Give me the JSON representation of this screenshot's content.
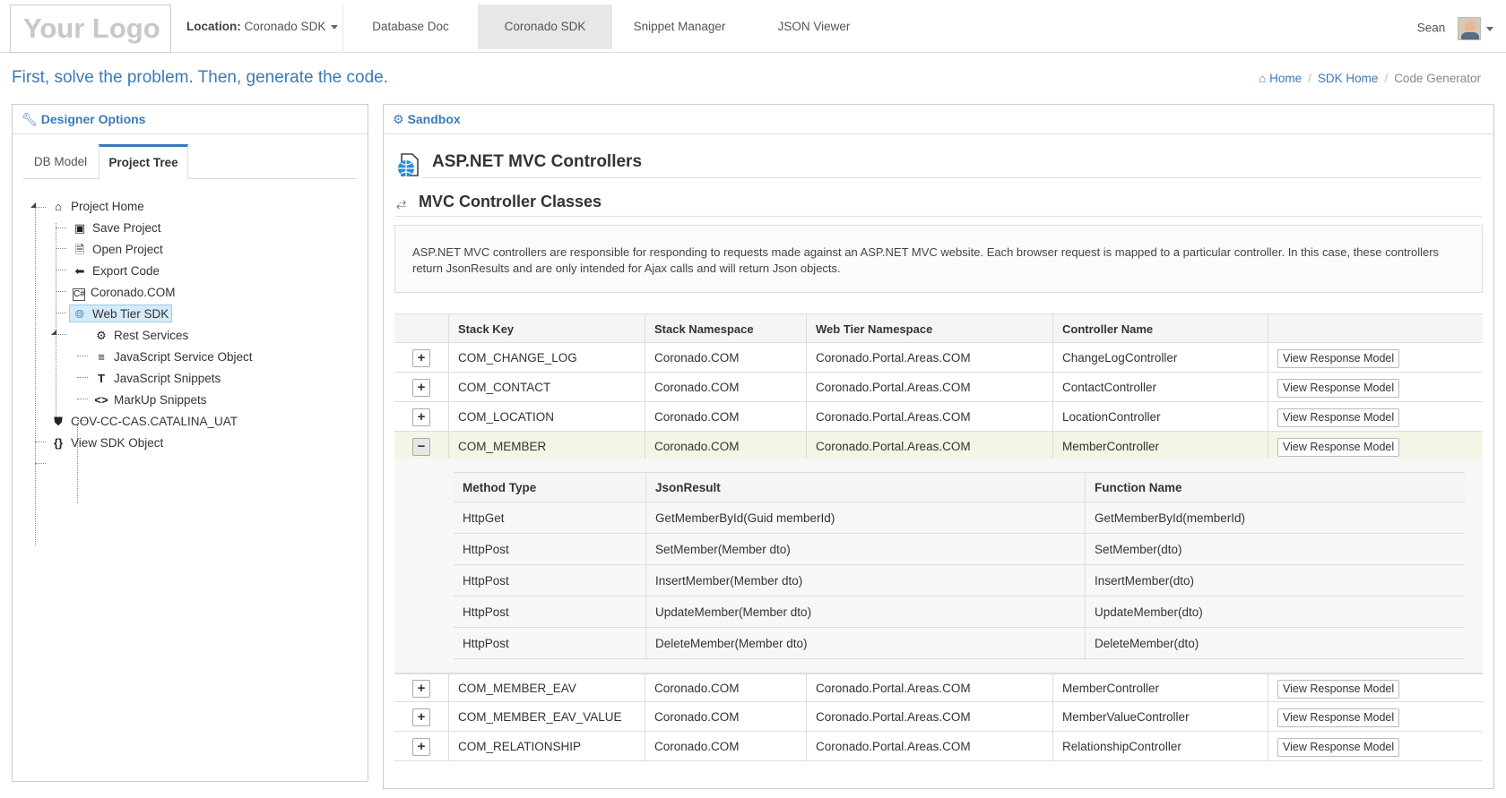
{
  "logo": {
    "text": "Your Logo"
  },
  "location": {
    "label": "Location:",
    "value": "Coronado SDK"
  },
  "nav": {
    "items": [
      {
        "label": "Database Doc",
        "active": false
      },
      {
        "label": "Coronado SDK",
        "active": true
      },
      {
        "label": "Snippet Manager",
        "active": false
      },
      {
        "label": "JSON Viewer",
        "active": false
      }
    ]
  },
  "user": {
    "name": "Sean"
  },
  "tagline": "First, solve the problem. Then, generate the code.",
  "breadcrumb": {
    "home": "Home",
    "sdk_home": "SDK Home",
    "current": "Code Generator"
  },
  "designer": {
    "title": "Designer Options",
    "tabs": [
      {
        "label": "DB Model"
      },
      {
        "label": "Project Tree"
      }
    ],
    "tree": [
      {
        "label": "Project Home",
        "icon": "home-icon"
      },
      {
        "label": "Save Project",
        "icon": "floppy-icon"
      },
      {
        "label": "Open Project",
        "icon": "open-file-icon"
      },
      {
        "label": "Export Code",
        "icon": "export-icon"
      },
      {
        "label": "Coronado.COM",
        "icon": "csharp-icon"
      },
      {
        "label": "Web Tier SDK",
        "icon": "globe-file-icon"
      },
      {
        "label": "Rest Services",
        "icon": "gear-icon"
      },
      {
        "label": "JavaScript Service Object",
        "icon": "js-file-icon"
      },
      {
        "label": "JavaScript Snippets",
        "icon": "text-icon"
      },
      {
        "label": "MarkUp Snippets",
        "icon": "code-icon"
      },
      {
        "label": "COV-CC-CAS.CATALINA_UAT",
        "icon": "database-icon"
      },
      {
        "label": "View SDK Object",
        "icon": "braces-icon"
      }
    ]
  },
  "sandbox": {
    "title": "Sandbox",
    "heading": "ASP.NET MVC Controllers",
    "subheading": "MVC Controller Classes",
    "description": "ASP.NET MVC controllers are responsible for responding to requests made against an ASP.NET MVC website. Each browser request is mapped to a particular controller. In this case, these controllers return JsonResults and are only intended for Ajax calls and will return Json objects.",
    "columns": [
      "Stack Key",
      "Stack Namespace",
      "Web Tier Namespace",
      "Controller Name"
    ],
    "button_label": "View Response Model",
    "rows": [
      {
        "key": "COM_CHANGE_LOG",
        "ns": "Coronado.COM",
        "web": "Coronado.Portal.Areas.COM",
        "ctrl": "ChangeLogController",
        "expanded": false
      },
      {
        "key": "COM_CONTACT",
        "ns": "Coronado.COM",
        "web": "Coronado.Portal.Areas.COM",
        "ctrl": "ContactController",
        "expanded": false
      },
      {
        "key": "COM_LOCATION",
        "ns": "Coronado.COM",
        "web": "Coronado.Portal.Areas.COM",
        "ctrl": "LocationController",
        "expanded": false
      },
      {
        "key": "COM_MEMBER",
        "ns": "Coronado.COM",
        "web": "Coronado.Portal.Areas.COM",
        "ctrl": "MemberController",
        "expanded": true
      },
      {
        "key": "COM_MEMBER_EAV",
        "ns": "Coronado.COM",
        "web": "Coronado.Portal.Areas.COM",
        "ctrl": "MemberController",
        "expanded": false
      },
      {
        "key": "COM_MEMBER_EAV_VALUE",
        "ns": "Coronado.COM",
        "web": "Coronado.Portal.Areas.COM",
        "ctrl": "MemberValueController",
        "expanded": false
      },
      {
        "key": "COM_RELATIONSHIP",
        "ns": "Coronado.COM",
        "web": "Coronado.Portal.Areas.COM",
        "ctrl": "RelationshipController",
        "expanded": false
      }
    ],
    "sub_columns": [
      "Method Type",
      "JsonResult",
      "Function Name"
    ],
    "sub_rows": [
      {
        "method": "HttpGet",
        "json": "GetMemberById(Guid memberId)",
        "fn": "GetMemberById(memberId)"
      },
      {
        "method": "HttpPost",
        "json": "SetMember(Member dto)",
        "fn": "SetMember(dto)"
      },
      {
        "method": "HttpPost",
        "json": "InsertMember(Member dto)",
        "fn": "InsertMember(dto)"
      },
      {
        "method": "HttpPost",
        "json": "UpdateMember(Member dto)",
        "fn": "UpdateMember(dto)"
      },
      {
        "method": "HttpPost",
        "json": "DeleteMember(Member dto)",
        "fn": "DeleteMember(dto)"
      }
    ]
  },
  "colors": {
    "accent": "#3b7ab8",
    "highlight_row": "#f2f6e6",
    "tree_selected": "#d6ebf9"
  }
}
